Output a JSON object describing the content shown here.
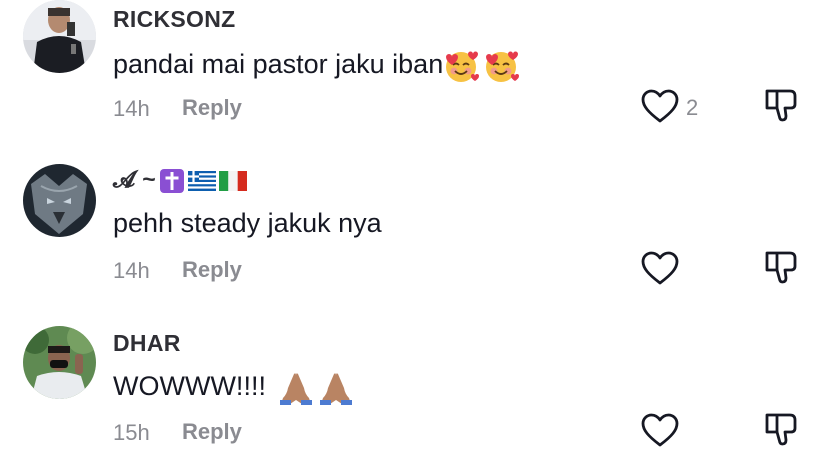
{
  "comments": [
    {
      "username": "RICKSONZ",
      "text": "pandai mai pastor jaku iban",
      "emojis": [
        "smiling-face-with-hearts",
        "smiling-face-with-hearts"
      ],
      "time": "14h",
      "reply_label": "Reply",
      "likes": "2"
    },
    {
      "username": "𝓐 ~",
      "username_badges": [
        "latin-cross",
        "greece-flag",
        "italy-flag"
      ],
      "text": "pehh steady jakuk nya",
      "time": "14h",
      "reply_label": "Reply",
      "likes": ""
    },
    {
      "username": "DHAR",
      "text": "WOWWW!!!!",
      "emojis": [
        "folded-hands",
        "folded-hands"
      ],
      "time": "15h",
      "reply_label": "Reply",
      "likes": ""
    }
  ],
  "colors": {
    "username": "#2f2f35",
    "text": "#161823",
    "meta": "#8a8b91",
    "background": "#ffffff"
  },
  "icons": {
    "like": "heart-outline-icon",
    "dislike": "thumbs-down-outline-icon"
  }
}
